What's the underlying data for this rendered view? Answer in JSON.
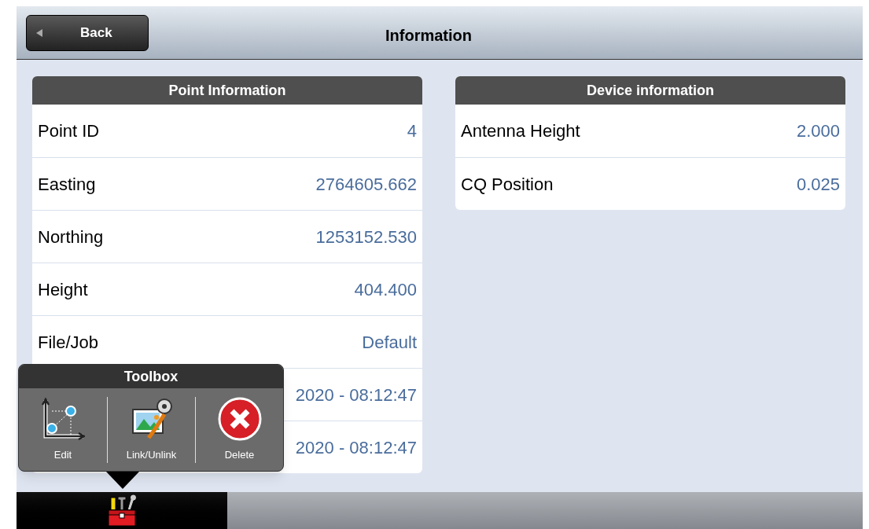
{
  "header": {
    "back_button": "Back",
    "title": "Information"
  },
  "panels": [
    {
      "title": "Point Information",
      "rows": [
        {
          "label": "Point ID",
          "value": "4"
        },
        {
          "label": "Easting",
          "value": "2764605.662"
        },
        {
          "label": "Northing",
          "value": "1253152.530"
        },
        {
          "label": "Height",
          "value": "404.400"
        },
        {
          "label": "File/Job",
          "value": "Default"
        },
        {
          "value": "2020 - 08:12:47"
        },
        {
          "value": "2020 - 08:12:47"
        }
      ]
    },
    {
      "title": "Device information",
      "rows": [
        {
          "label": "Antenna Height",
          "value": "2.000"
        },
        {
          "label": "CQ Position",
          "value": "0.025"
        }
      ]
    }
  ],
  "toolbox": {
    "title": "Toolbox",
    "tools": [
      {
        "kind": "edit",
        "label": "Edit"
      },
      {
        "kind": "link",
        "label": "Link/Unlink"
      },
      {
        "kind": "delete",
        "label": "Delete"
      }
    ]
  }
}
